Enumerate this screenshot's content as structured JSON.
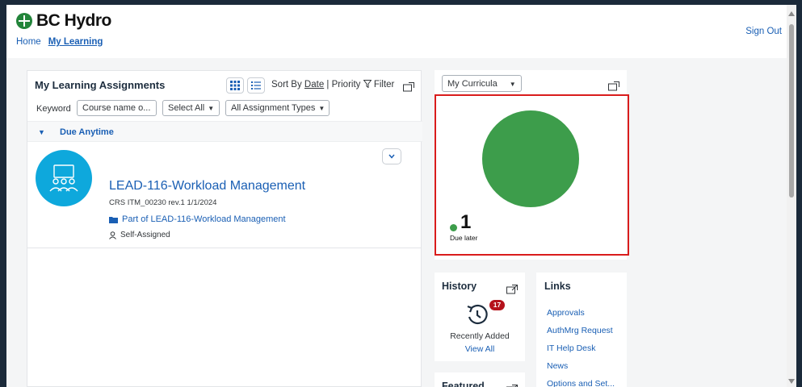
{
  "header": {
    "logo_text": "BC Hydro",
    "breadcrumb": {
      "home": "Home",
      "current": "My Learning"
    },
    "sign_out": "Sign Out"
  },
  "assignments": {
    "title": "My Learning Assignments",
    "sort_by": "Sort By",
    "sort_date": "Date",
    "sort_separator": "|",
    "sort_priority": "Priority",
    "filter": "Filter",
    "keyword_label": "Keyword",
    "keyword_placeholder": "Course name o...",
    "select_all": "Select All",
    "assignment_types": "All Assignment Types",
    "group_label": "Due Anytime",
    "item": {
      "title": "LEAD-116-Workload Management",
      "code": "CRS ITM_00230 rev.1 1/1/2024",
      "part_of": "Part of LEAD-116-Workload Management",
      "assigned": "Self-Assigned"
    }
  },
  "curricula": {
    "select_label": "My Curricula",
    "chart_value": "1",
    "chart_label": "Due later",
    "color": "#3d9d4b"
  },
  "chart_data": {
    "type": "pie",
    "categories": [
      "Due later"
    ],
    "values": [
      1
    ]
  },
  "history": {
    "title": "History",
    "badge_count": "17",
    "recently_added": "Recently Added",
    "view_all": "View All"
  },
  "featured": {
    "title": "Featured"
  },
  "links": {
    "title": "Links",
    "items": [
      "Approvals",
      "AuthMrg Request",
      "IT Help Desk",
      "News",
      "Options and Set..."
    ]
  },
  "colors": {
    "accent": "#1a5fb4",
    "brand_green": "#22843a",
    "highlight": "#d91c1c",
    "badge": "#b5121b"
  }
}
